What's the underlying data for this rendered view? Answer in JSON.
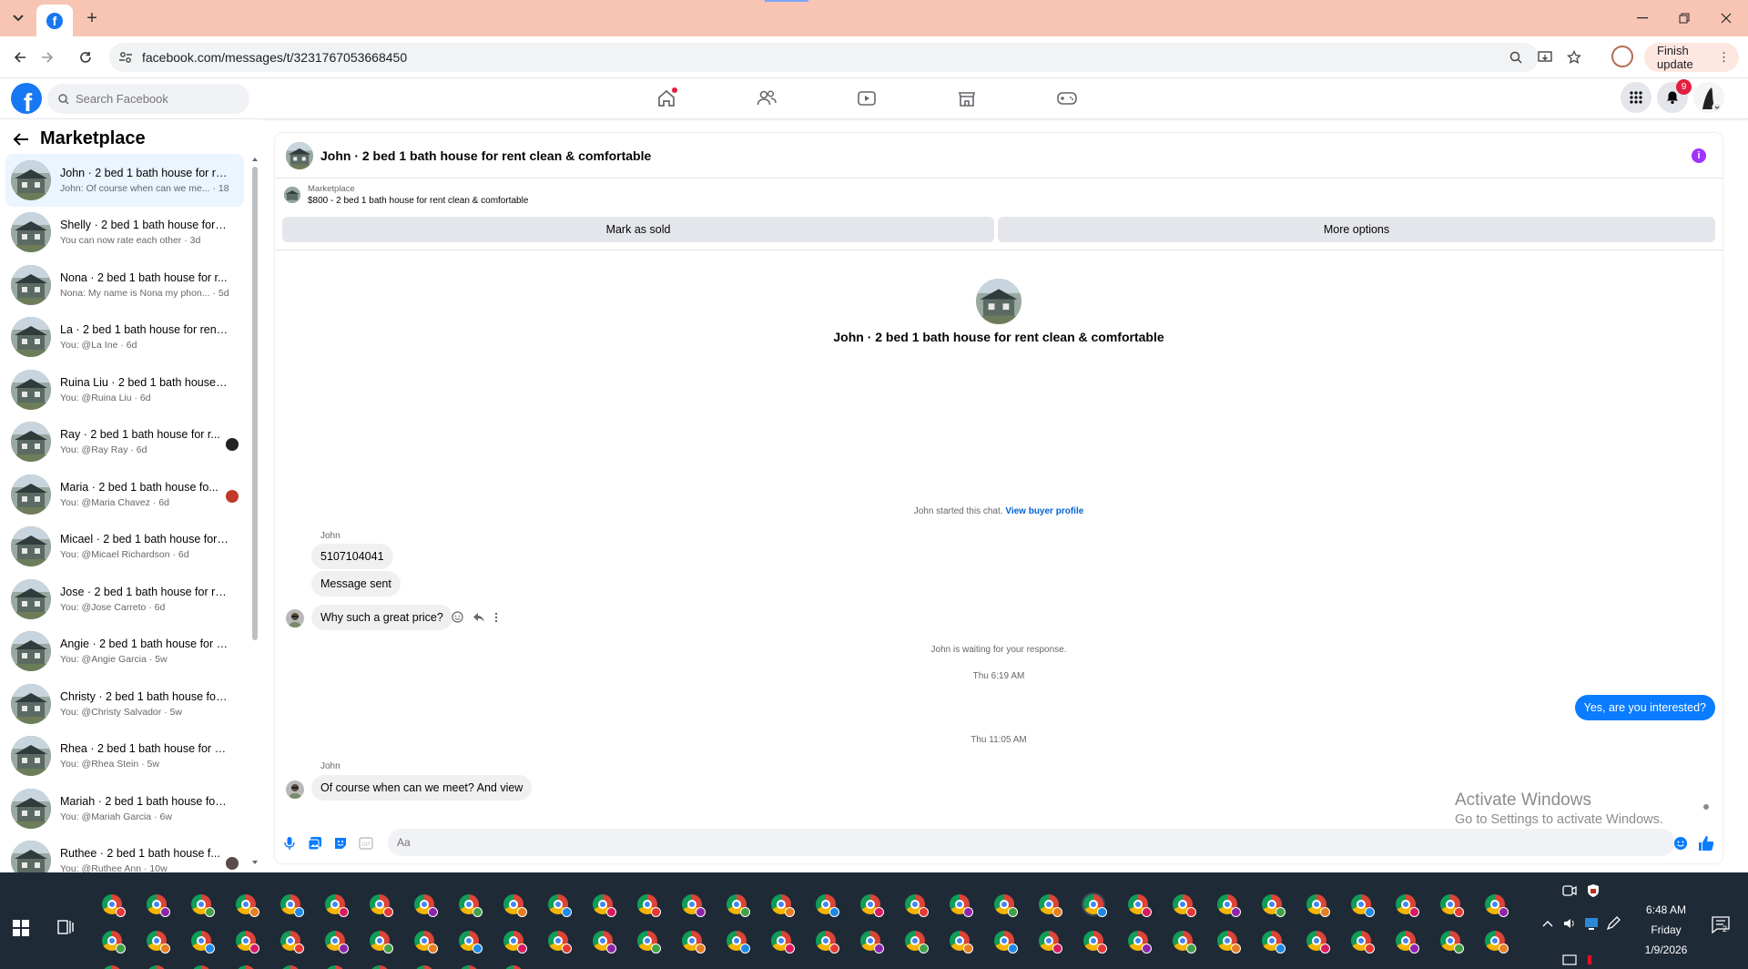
{
  "browser": {
    "url": "facebook.com/messages/t/3231767053668450",
    "finish_update": "Finish update"
  },
  "header": {
    "search_placeholder": "Search Facebook",
    "notification_count": "9"
  },
  "sidebar": {
    "title": "Marketplace",
    "conversations": [
      {
        "title": "John · 2 bed 1 bath house for re...",
        "subtitle": "John: Of course when can we me... · 18h"
      },
      {
        "title": "Shelly · 2 bed 1 bath house for r...",
        "subtitle": "You can now rate each other · 3d"
      },
      {
        "title": "Nona · 2 bed 1 bath house for r...",
        "subtitle": "Nona: My name is Nona my phon... · 5d"
      },
      {
        "title": "La · 2 bed 1 bath house for rent ...",
        "subtitle": "You: @La Ine · 6d"
      },
      {
        "title": "Ruina Liu · 2 bed 1 bath house f...",
        "subtitle": "You: @Ruina Liu · 6d"
      },
      {
        "title": "Ray · 2 bed 1 bath house for r...",
        "subtitle": "You: @Ray Ray · 6d"
      },
      {
        "title": "Maria · 2 bed 1 bath house fo...",
        "subtitle": "You: @Maria Chavez · 6d"
      },
      {
        "title": "Micael · 2 bed 1 bath house for ...",
        "subtitle": "You: @Micael Richardson · 6d"
      },
      {
        "title": "Jose · 2 bed 1 bath house for re...",
        "subtitle": "You: @Jose Carreto · 6d"
      },
      {
        "title": "Angie · 2 bed 1 bath house for r...",
        "subtitle": "You: @Angie Garcia · 5w"
      },
      {
        "title": "Christy · 2 bed 1 bath house for ...",
        "subtitle": "You: @Christy Salvador · 5w"
      },
      {
        "title": "Rhea · 2 bed 1 bath house for re...",
        "subtitle": "You: @Rhea Stein · 5w"
      },
      {
        "title": "Mariah · 2 bed 1 bath house for ...",
        "subtitle": "You: @Mariah Garcia · 6w"
      },
      {
        "title": "Ruthee · 2 bed 1 bath house f...",
        "subtitle": "You: @Ruthee Ann · 10w"
      }
    ]
  },
  "chat": {
    "title": "John · 2 bed 1 bath house for rent clean & comfortable",
    "marketplace_label": "Marketplace",
    "listing": "$800 - 2 bed 1 bath house for rent clean & comfortable",
    "mark_sold": "Mark as sold",
    "more_options": "More options",
    "center_title": "John · 2 bed 1 bath house for rent clean & comfortable",
    "started": "John started this chat.",
    "view_profile": "View buyer profile",
    "sender1": "John",
    "msg1": "5107104041",
    "msg2": "Message sent",
    "msg3": "Why such a great price?",
    "waiting": "John is waiting for your response.",
    "time1": "Thu 6:19 AM",
    "my_msg": "Yes, are you interested?",
    "time2": "Thu 11:05 AM",
    "sender2": "John",
    "msg4": "Of course when can we meet? And view",
    "composer_placeholder": "Aa"
  },
  "watermark": {
    "line1": "Activate Windows",
    "line2": "Go to Settings to activate Windows."
  },
  "clock": {
    "time": "6:48 AM",
    "day": "Friday",
    "date": "1/9/2026"
  },
  "tray": {
    "notifications": "2"
  },
  "colors": {
    "fb_blue": "#1877f2",
    "tab_strip": "#f8c5b5",
    "taskbar": "#1f2a37",
    "my_bubble": "#0a7cff"
  }
}
